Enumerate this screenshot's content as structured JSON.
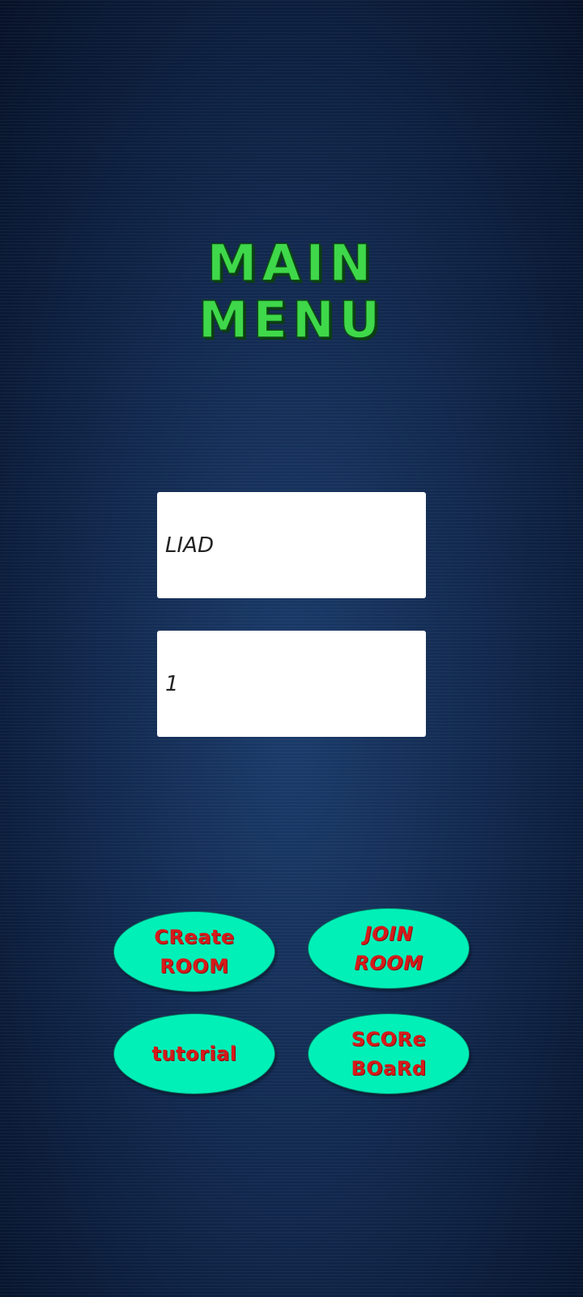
{
  "title": {
    "line1": "MAIN",
    "line2": "MENU"
  },
  "inputs": {
    "name_value": "LIAD",
    "room_value": "1"
  },
  "buttons": {
    "create_room": "CReate\nROOM",
    "join_room": "JOIN\nROOM",
    "tutorial": "tutorial",
    "score_board": "SCORe\nBOaRd"
  },
  "colors": {
    "title_green": "#3fd84a",
    "button_fill": "#00f0b8",
    "button_text": "#d61a1a",
    "background": "#12294f"
  }
}
